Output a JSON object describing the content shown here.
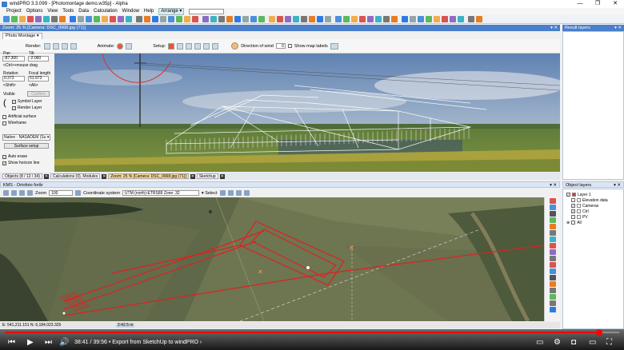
{
  "window": {
    "title": "windPRO 3.3.099 - [Photomontage demo.w35p] - Alpha",
    "controls": [
      "—",
      "❐",
      "✕"
    ]
  },
  "menu": {
    "items": [
      "Project",
      "Options",
      "View",
      "Tools",
      "Data",
      "Calculation",
      "Window",
      "Help"
    ],
    "arrange": "Arrange ▾"
  },
  "photo_panel": {
    "header": "Zoom: 25 % [Camera: DSC_0068.jpg (71)]",
    "tab": "Photo Montage ▾",
    "render_label": "Render:",
    "animate_label": "Animate:",
    "setup_label": "Setup:",
    "wind_label": "Direction of wind",
    "wind_value": "0",
    "map_labels": "Show map labels"
  },
  "controls": {
    "pan_label": "Pan",
    "tilt_label": "Tilt",
    "pan_value": "-87.300",
    "tilt_value": "-2.060",
    "drag_hint": "<Ctrl>+mouse drag",
    "rotation_label": "Rotation",
    "focal_label": "Focal length",
    "rotation_value": "0.373",
    "focal_value": "51.973",
    "shift_hint": "<Shift>",
    "alt_hint": "<Alt>",
    "visible_label": "Visible",
    "confirm_btn": "Confirm",
    "symbol_layer": "Symbol Layer",
    "render_layer": "Render Layer",
    "artificial_surface": "Artificial surface",
    "wireframe": "Wireframe",
    "surface_select": "Native - NASADEM (Su ▾",
    "surface_setup": "Surface setup",
    "auto_erase": "Auto erase",
    "show_horizon": "Show horizon line"
  },
  "dock_tabs": [
    {
      "label": "Objects (8 / 12 / 34)",
      "active": false
    },
    {
      "label": "Calculations (0), Modules",
      "active": false
    },
    {
      "label": "Zoom: 25 % [Camera: DSC_0068.jpg (71)]",
      "active": true
    },
    {
      "label": "Sketchup",
      "active": false
    }
  ],
  "map_panel": {
    "header": "KMS - Ortofoto forår",
    "zoom_label": "Zoom",
    "zoom_value": "100",
    "coord_label": "Coordinate system",
    "coord_value": "UTM (north)-ETRS89 Zone: 32",
    "select_label": "Select",
    "coords_text": "E: 541,211.151  N: 6,184,023.325",
    "distance_text": "2:42.5 m"
  },
  "right": {
    "result_layers": "Result layers",
    "object_layers": "Object layers",
    "tree": [
      {
        "label": "Layer 1",
        "checked": true,
        "color": "#d33"
      },
      {
        "label": "Elevation data",
        "checked": false,
        "color": "#888"
      },
      {
        "label": "Cameras",
        "checked": true,
        "color": "#777"
      },
      {
        "label": "Ctrl",
        "checked": true,
        "color": "#777"
      },
      {
        "label": "PV",
        "checked": false,
        "color": "#777"
      },
      {
        "label": "All",
        "checked": false,
        "color": "#777"
      }
    ]
  },
  "player": {
    "time": "38:41 / 39:56  •  Export from SketchUp to windPRO  ›",
    "progress": 0.968
  }
}
